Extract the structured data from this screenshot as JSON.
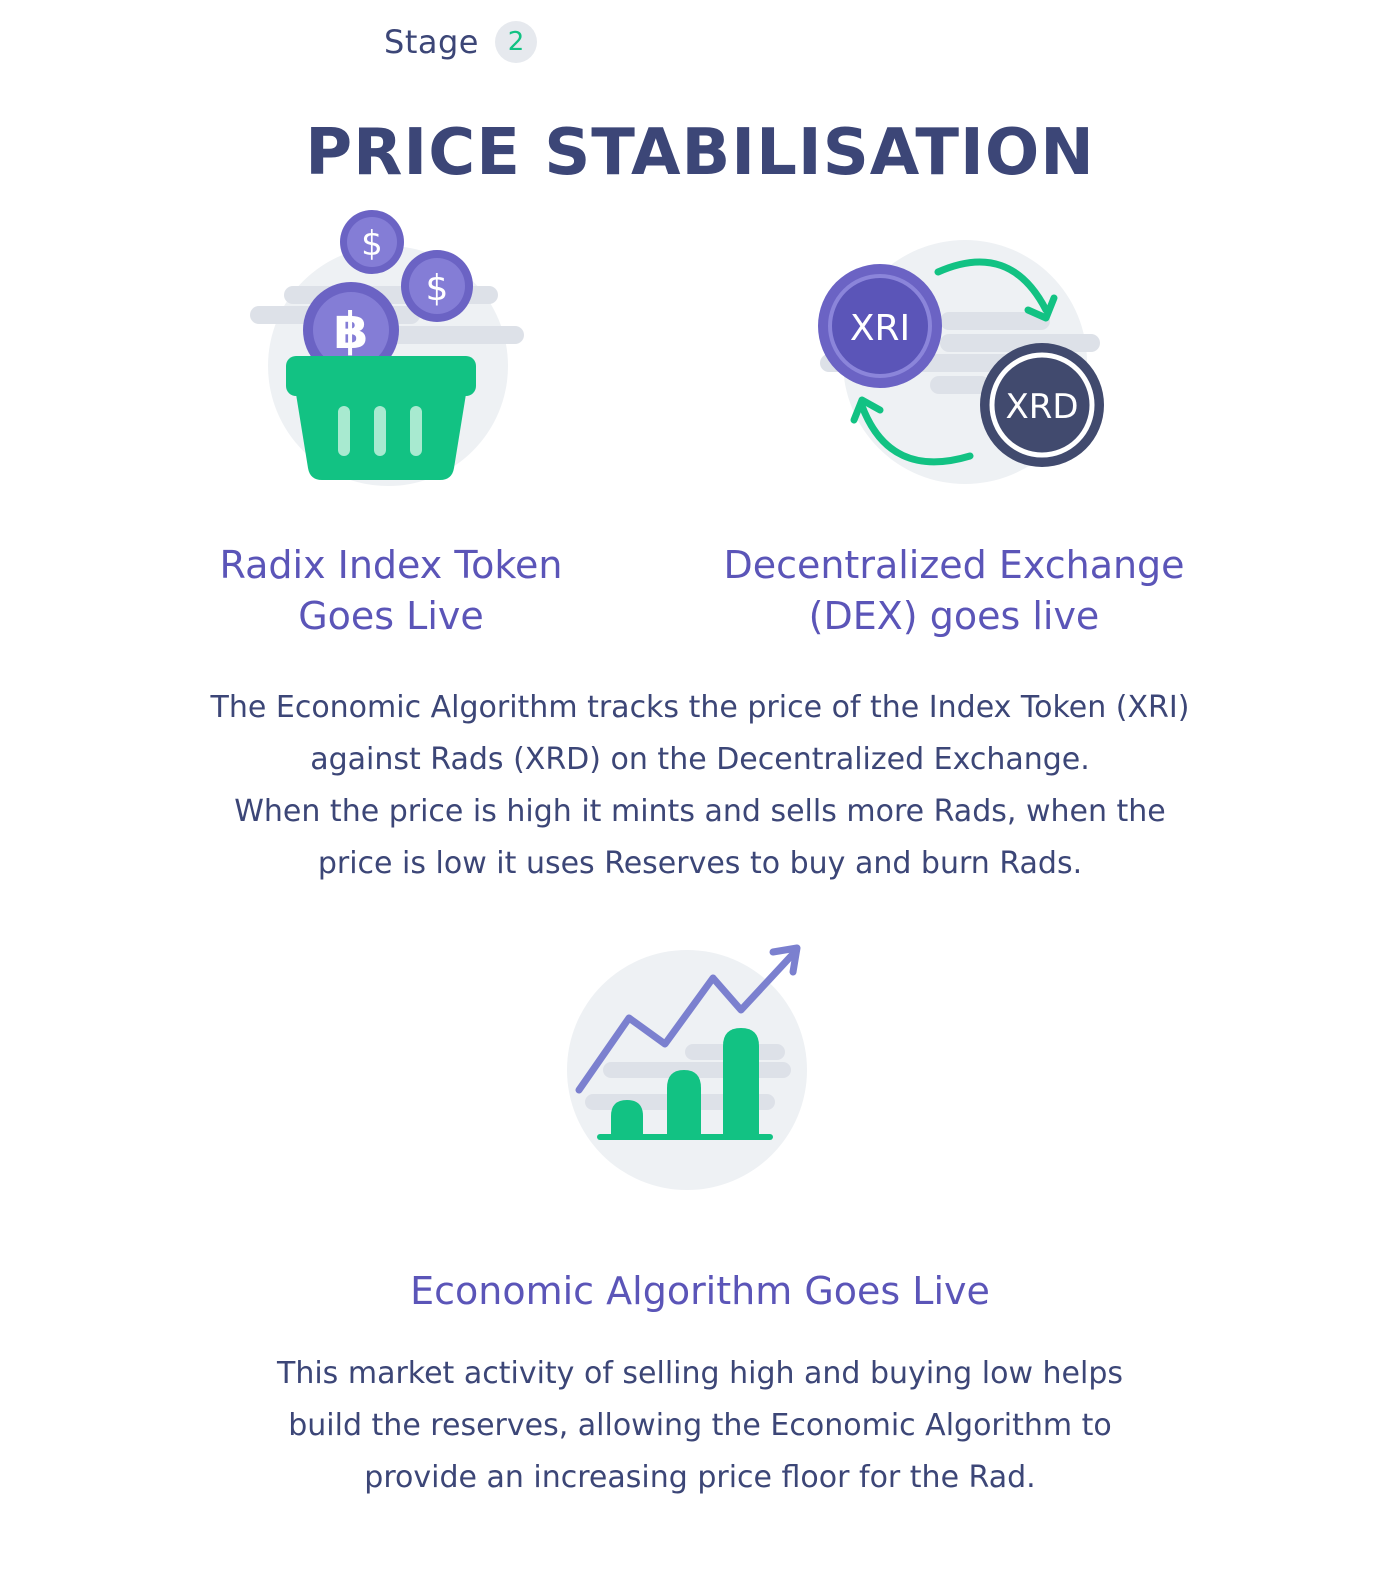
{
  "header": {
    "stage_label": "Stage",
    "stage_number": "2",
    "title": "PRICE STABILISATION"
  },
  "features": [
    {
      "icon": "coin-basket-icon",
      "title_lines": [
        "Radix Index Token",
        "Goes Live"
      ]
    },
    {
      "icon": "xri-xrd-exchange-icon",
      "coin_labels": [
        "XRI",
        "XRD"
      ],
      "title_lines": [
        "Decentralized Exchange",
        "(DEX) goes live"
      ]
    }
  ],
  "description_1": [
    "The Economic Algorithm tracks the price of the Index Token (XRI)",
    "against Rads (XRD) on the Decentralized Exchange.",
    "When the price is high it mints and sells more Rads, when the",
    "price is low it uses Reserves to buy and burn Rads."
  ],
  "algorithm": {
    "icon": "growth-chart-icon",
    "title": "Economic Algorithm Goes Live",
    "description": [
      "This market activity of selling high and buying low helps",
      "build the reserves, allowing the Economic Algorithm to",
      "provide an increasing price floor for the Rad."
    ]
  },
  "colors": {
    "text_dark": "#3c4677",
    "accent_purple": "#5b55b8",
    "coin_purple": "#6b63c4",
    "green": "#12c283",
    "navy_coin": "#414a6e",
    "bg_circle": "#eef1f4"
  }
}
